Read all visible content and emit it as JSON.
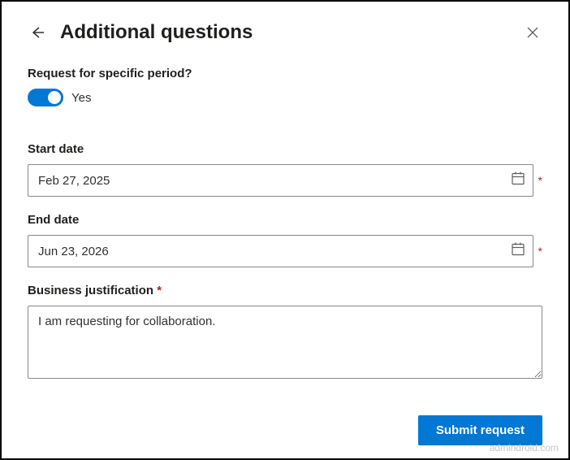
{
  "header": {
    "title": "Additional questions"
  },
  "form": {
    "specific_period": {
      "label": "Request for specific period?",
      "toggle_value": "Yes"
    },
    "start_date": {
      "label": "Start date",
      "value": "Feb 27, 2025"
    },
    "end_date": {
      "label": "End date",
      "value": "Jun 23, 2026"
    },
    "justification": {
      "label": "Business justification",
      "value": "I am requesting for collaboration."
    },
    "required_mark": "*"
  },
  "footer": {
    "submit_label": "Submit request"
  },
  "watermark": "admindroid.com"
}
